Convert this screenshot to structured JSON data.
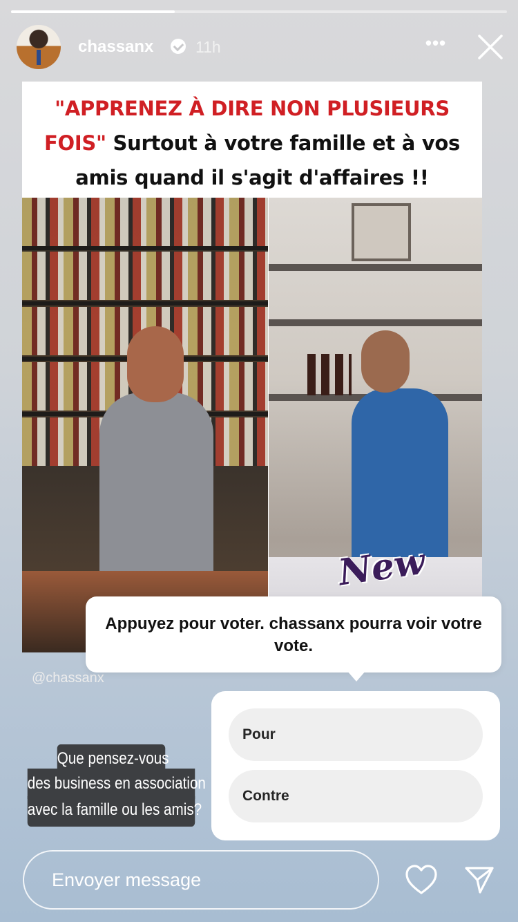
{
  "story": {
    "progress": 0.33,
    "username": "chassanx",
    "verified": true,
    "time": "11h",
    "more_label": "•••"
  },
  "post": {
    "title_red": "\"APPRENEZ À DIRE NON PLUSIEURS FOIS\"",
    "title_rest": " Surtout à votre famille et à vos amis quand il s'agit d'affaires !!",
    "sticker": "New",
    "watermark": "@chassanx"
  },
  "tooltip": {
    "text": "Appuyez pour voter. chassanx pourra voir votre vote."
  },
  "poll": {
    "options": [
      {
        "label": "Pour"
      },
      {
        "label": "Contre"
      }
    ]
  },
  "question": {
    "lines": [
      "Que pensez-vous",
      "des business en association",
      "avec la famille ou les amis?"
    ]
  },
  "footer": {
    "message_placeholder": "Envoyer message"
  },
  "icons": {
    "close": "close-icon",
    "more": "more-icon",
    "verified": "verified-icon",
    "like": "heart-icon",
    "send": "send-icon"
  }
}
